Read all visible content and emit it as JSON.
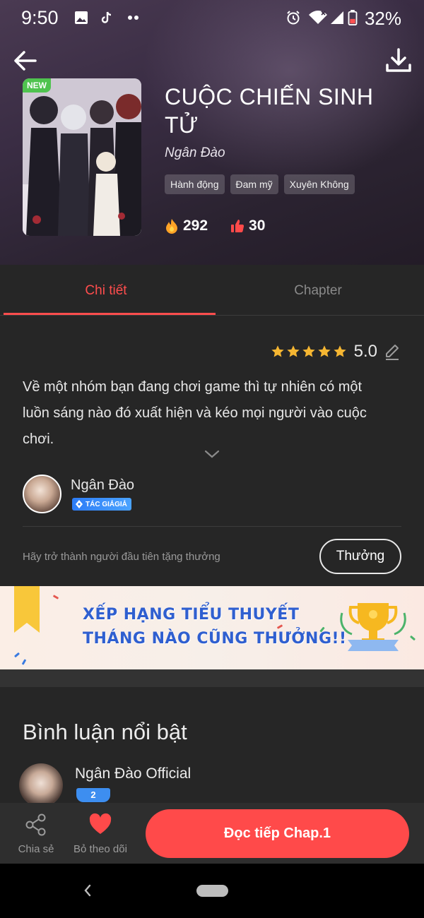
{
  "status_bar": {
    "time": "9:50",
    "battery": "32%"
  },
  "header": {
    "title": "CUỘC CHIẾN SINH TỬ",
    "author": "Ngân Đào",
    "badge": "NEW",
    "tags": [
      "Hành động",
      "Đam mỹ",
      "Xuyên Không"
    ],
    "views": "292",
    "likes": "30"
  },
  "tabs": [
    {
      "label": "Chi tiết",
      "active": true
    },
    {
      "label": "Chapter",
      "active": false
    }
  ],
  "detail": {
    "rating": "5.0",
    "stars": 5,
    "description": "Về một nhóm bạn đang chơi game thì tự nhiên có một luồn sáng nào đó xuất hiện và kéo mọi người vào cuộc chơi.",
    "author_name": "Ngân Đào",
    "author_badge": "TÁC GIẢGIẢ",
    "gift_text": "Hãy trở thành người đầu tiên tặng thưởng",
    "gift_button": "Thưởng"
  },
  "banner": {
    "line1": "XẾP HẠNG TIỂU THUYẾT",
    "line2": "THÁNG NÀO CŨNG THƯỞNG!!"
  },
  "comments": {
    "title": "Bình luận nổi bật",
    "items": [
      {
        "name": "Ngân Đào Official",
        "level": "2"
      }
    ]
  },
  "action_bar": {
    "share": "Chia sẻ",
    "unfollow": "Bỏ theo dõi",
    "read": "Đọc tiếp Chap.1"
  },
  "colors": {
    "accent": "#ff4a4a",
    "background": "#262626",
    "star": "#f5b632",
    "badge_blue": "#2d7cf6"
  }
}
